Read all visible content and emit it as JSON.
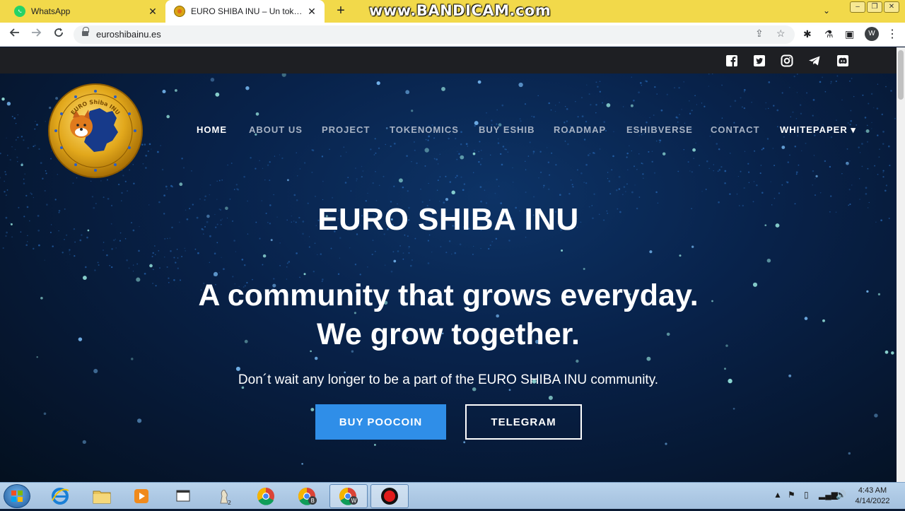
{
  "browser": {
    "tabs": [
      {
        "title": "WhatsApp",
        "active": false
      },
      {
        "title": "EURO SHIBA INU – Un token dec",
        "active": true
      }
    ],
    "new_tab": "+",
    "watermark": "www.BANDICAM.com",
    "url": "euroshibainu.es",
    "profile_initial": "W"
  },
  "site": {
    "social": [
      "facebook-icon",
      "twitter-icon",
      "instagram-icon",
      "telegram-icon",
      "discord-icon"
    ],
    "logo_text": "EURO Shiba INU",
    "nav": [
      {
        "label": "HOME",
        "active": true
      },
      {
        "label": "ABOUT US"
      },
      {
        "label": "PROJECT"
      },
      {
        "label": "TOKENOMICS"
      },
      {
        "label": "BUY ESHIB"
      },
      {
        "label": "ROADMAP"
      },
      {
        "label": "ESHIBVERSE"
      },
      {
        "label": "CONTACT"
      },
      {
        "label": "WHITEPAPER ▾",
        "highlight": true
      }
    ],
    "hero": {
      "brand": "EURO SHIBA INU",
      "tagline_1": "A community that grows everyday.",
      "tagline_2": "We grow together.",
      "subtitle": "Don´t wait any longer to be a part of the EURO SHIBA INU community.",
      "button_primary": "BUY POOCOIN",
      "button_secondary": "TELEGRAM"
    },
    "colors": {
      "accent": "#2f8ee8",
      "topbar": "#1e1f23",
      "hero_bg": "#08224a"
    }
  },
  "taskbar": {
    "apps": [
      "ie-icon",
      "explorer-icon",
      "media-player-icon",
      "window-icon",
      "chess-icon",
      "chrome-icon",
      "chrome-b-icon",
      "chrome-w-icon",
      "bandicam-record-icon"
    ],
    "clock_time": "4:43 AM",
    "clock_date": "4/14/2022"
  }
}
